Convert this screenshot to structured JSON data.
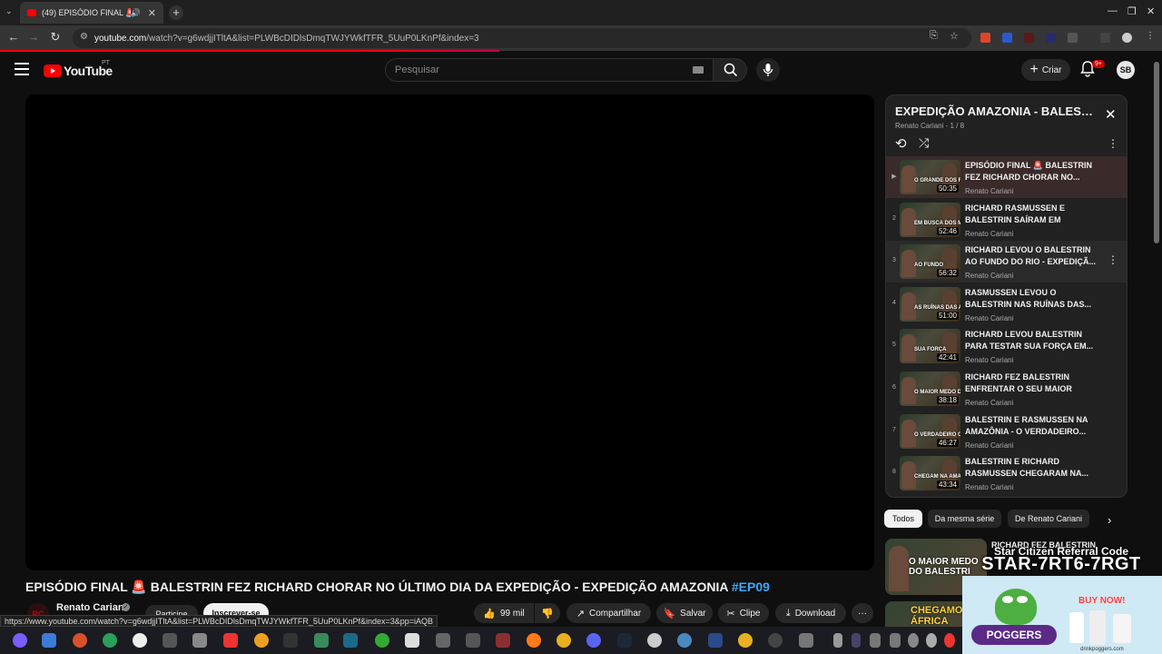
{
  "browser": {
    "tab_title": "(49) EPISÓDIO FINAL 🚨 BALESTRIN FEZ RICHARD CHORAR",
    "url_domain": "youtube.com",
    "url_path": "/watch?v=g6wdjjITltA&list=PLWBcDIDlsDmqTWJYWkfTFR_5UuP0LKnPf&index=3",
    "status_url": "https://www.youtube.com/watch?v=g6wdjjITltA&list=PLWBcDIDlsDmqTWJYWkfTFR_5UuP0LKnPf&index=3&pp=iAQB"
  },
  "header": {
    "logo_text": "YouTube",
    "country_code": "PT",
    "search_placeholder": "Pesquisar",
    "create_label": "Criar",
    "notif_count": "9+",
    "avatar_initials": "SB"
  },
  "video": {
    "title": "EPISÓDIO FINAL 🚨 BALESTRIN FEZ RICHARD CHORAR NO ÚLTIMO DIA DA EXPEDIÇÃO - EXPEDIÇÃO AMAZONIA",
    "hashtag": "#EP09",
    "channel": "Renato Cariani",
    "channel_initials": "RC",
    "join_label": "Participe",
    "subscribe_label": "Inscrever-se",
    "likes": "99 mil",
    "share_label": "Compartilhar",
    "save_label": "Salvar",
    "clip_label": "Clipe",
    "download_label": "Download"
  },
  "playlist": {
    "title": "EXPEDIÇÃO AMAZONIA - BALESTRIN",
    "subtitle": "Renato Cariani - 1 / 8",
    "items": [
      {
        "idx": "▶",
        "title": "EPISÓDIO FINAL 🚨 BALESTRIN FEZ RICHARD CHORAR NO...",
        "channel": "Renato Cariani",
        "duration": "50:35",
        "caption": "O GRANDE DOS RIOS"
      },
      {
        "idx": "2",
        "title": "RICHARD RASMUSSEN E BALESTRIN SAÍRAM EM BUSCA...",
        "channel": "Renato Cariani",
        "duration": "52:46",
        "caption": "EM BUSCA DOS MONST"
      },
      {
        "idx": "3",
        "title": "RICHARD LEVOU O BALESTRIN AO FUNDO DO RIO - EXPEDIÇÃ...",
        "channel": "Renato Cariani",
        "duration": "56:32",
        "caption": "AO FUNDO"
      },
      {
        "idx": "4",
        "title": "RASMUSSEN LEVOU O BALESTRIN NAS RUÍNAS DAS...",
        "channel": "Renato Cariani",
        "duration": "51:00",
        "caption": "AS RUÍNAS DAS ARA"
      },
      {
        "idx": "5",
        "title": "RICHARD LEVOU BALESTRIN PARA TESTAR SUA FORÇA EM...",
        "channel": "Renato Cariani",
        "duration": "42:41",
        "caption": "SUA FORÇA"
      },
      {
        "idx": "6",
        "title": "RICHARD FEZ BALESTRIN ENFRENTAR O SEU MAIOR MED...",
        "channel": "Renato Cariani",
        "duration": "38:18",
        "caption": "O MAIOR MEDO DO BALE"
      },
      {
        "idx": "7",
        "title": "BALESTRIN E RASMUSSEN NA AMAZÔNIA - O VERDADEIRO...",
        "channel": "Renato Cariani",
        "duration": "46:27",
        "caption": "O VERDADEIRO OURO"
      },
      {
        "idx": "8",
        "title": "BALESTRIN E RICHARD RASMUSSEN CHEGARAM NA...",
        "channel": "Renato Cariani",
        "duration": "43:34",
        "caption": "CHEGAM NA AMAZ"
      }
    ]
  },
  "chips": [
    "Todos",
    "Da mesma série",
    "De Renato Cariani"
  ],
  "recommended": {
    "title": "RICHARD FEZ BALESTRIN",
    "thumb1_caption": "O MAIOR MEDO DO BALESTRI",
    "thumb2_caption": "CHEGAMOS NA ÁFRICA"
  },
  "overlay": {
    "title": "Star Citizen Referral Code",
    "code": "STAR-7RT6-7RGT",
    "buy_now": "BUY NOW!",
    "brand": "POGGERS",
    "site": "drinkpoggers.com"
  },
  "colors": {
    "accent": "#ff0000",
    "link": "#3ea6ff",
    "bg": "#0f0f0f"
  }
}
